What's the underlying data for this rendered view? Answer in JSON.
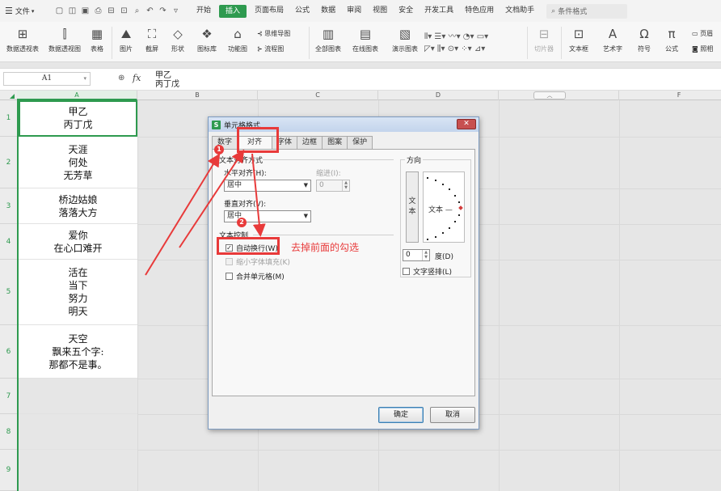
{
  "menubar": {
    "file_label": "文件",
    "tabs": [
      {
        "label": "开始",
        "active": false
      },
      {
        "label": "插入",
        "active": true
      },
      {
        "label": "页面布局",
        "active": false
      },
      {
        "label": "公式",
        "active": false
      },
      {
        "label": "数据",
        "active": false
      },
      {
        "label": "审阅",
        "active": false
      },
      {
        "label": "视图",
        "active": false
      },
      {
        "label": "安全",
        "active": false
      },
      {
        "label": "开发工具",
        "active": false
      },
      {
        "label": "特色应用",
        "active": false
      },
      {
        "label": "文档助手",
        "active": false
      }
    ],
    "search_label": "条件格式"
  },
  "ribbon": {
    "pivot_table": "数据透视表",
    "pivot_chart": "数据透视图",
    "table": "表格",
    "picture": "图片",
    "screenshot": "截屏",
    "shape": "形状",
    "icon_lib": "图标库",
    "func_chart": "功能图",
    "mindmap": "思维导图",
    "flowchart": "流程图",
    "all_charts": "全部图表",
    "online_charts": "在线图表",
    "demo_charts": "演示图表",
    "slicer": "切片器",
    "textbox": "文本框",
    "wordart": "艺术字",
    "symbol": "符号",
    "formula": "公式",
    "header_footer": "页眉",
    "camera": "照相"
  },
  "formula_bar": {
    "name_box": "A1",
    "fx": "fx",
    "content_line1": "甲乙",
    "content_line2": "丙丁戊"
  },
  "sheet": {
    "columns": [
      "A",
      "B",
      "C",
      "D",
      "E",
      "F"
    ],
    "rows": [
      {
        "num": "1",
        "lines": [
          "甲乙",
          "丙丁戊"
        ]
      },
      {
        "num": "2",
        "lines": [
          "天涯",
          "何处",
          "无芳草"
        ]
      },
      {
        "num": "3",
        "lines": [
          "桥边姑娘",
          "落落大方"
        ]
      },
      {
        "num": "4",
        "lines": [
          "爱你",
          "在心口难开"
        ]
      },
      {
        "num": "5",
        "lines": [
          "活在",
          "当下",
          "努力",
          "明天"
        ]
      },
      {
        "num": "6",
        "lines": [
          "天空",
          "飘来五个字:",
          "那都不是事。"
        ]
      },
      {
        "num": "7",
        "lines": []
      },
      {
        "num": "8",
        "lines": []
      },
      {
        "num": "9",
        "lines": []
      }
    ]
  },
  "dialog": {
    "title": "单元格格式",
    "close": "✕",
    "tabs": [
      {
        "label": "数字",
        "active": false
      },
      {
        "label": "对齐",
        "active": true
      },
      {
        "label": "字体",
        "active": false
      },
      {
        "label": "边框",
        "active": false
      },
      {
        "label": "图案",
        "active": false
      },
      {
        "label": "保护",
        "active": false
      }
    ],
    "align_section": "文本对齐方式",
    "h_align_label": "水平对齐(H):",
    "h_align_value": "居中",
    "indent_label": "缩进(I):",
    "indent_value": "0",
    "v_align_label": "垂直对齐(V):",
    "v_align_value": "居中",
    "control_section": "文本控制",
    "wrap_text": "自动换行(W)",
    "wrap_checked": true,
    "shrink_fit": "缩小字体填充(K)",
    "merge_cells": "合并单元格(M)",
    "orientation_section": "方向",
    "orient_vertical_chars": [
      "文",
      "本"
    ],
    "orient_text": "文本 —",
    "degree_value": "0",
    "degree_label": "度(D)",
    "vertical_text": "文字竖排(L)",
    "ok": "确定",
    "cancel": "取消"
  },
  "annotations": {
    "badge1": "1",
    "badge2": "2",
    "note": "去掉前面的勾选"
  },
  "colors": {
    "accent": "#2e9a4f",
    "annotation": "#e83a3a"
  }
}
